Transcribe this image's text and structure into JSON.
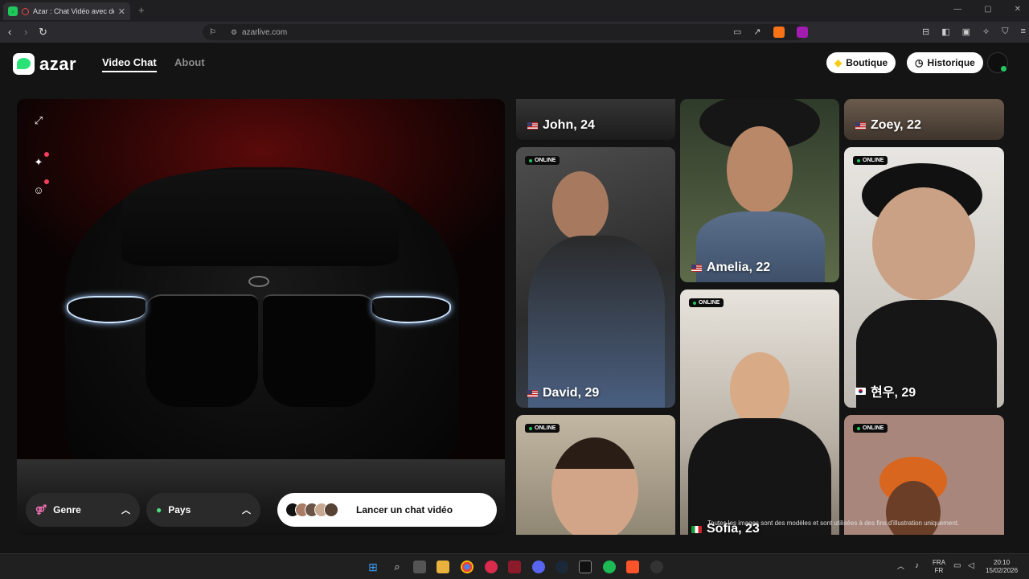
{
  "browser": {
    "tab_title": "Azar : Chat Vidéo avec de no",
    "tab_close": "✕",
    "new_tab": "+",
    "url": "azarlive.com",
    "window_controls": [
      "—",
      "▢",
      "✕"
    ]
  },
  "header": {
    "logo_text": "azar",
    "nav": {
      "video_chat": "Video Chat",
      "about": "About"
    },
    "boutique_label": "Boutique",
    "historique_label": "Historique"
  },
  "video_panel": {
    "filters": {
      "genre_label": "Genre",
      "pays_label": "Pays"
    },
    "launch_label": "Lancer un chat vidéo"
  },
  "profiles": [
    {
      "name": "John, 24",
      "flag": "us",
      "online": false
    },
    {
      "name": "Amelia, 22",
      "flag": "us",
      "online": false
    },
    {
      "name": "Zoey, 22",
      "flag": "us",
      "online": false
    },
    {
      "name": "David, 29",
      "flag": "us",
      "online": true
    },
    {
      "name": "Sofia, 23",
      "flag": "it",
      "online": true
    },
    {
      "name": "현우, 29",
      "flag": "kr",
      "online": true
    },
    {
      "name": "",
      "flag": "",
      "online": true
    },
    {
      "name": "",
      "flag": "",
      "online": true
    }
  ],
  "online_label": "ONLINE",
  "disclaimer": "Toutes les images sont des modèles et sont utilisées à des fins d'illustration uniquement.",
  "taskbar": {
    "lang_top": "FRA",
    "lang_bottom": "FR",
    "time": "20:10",
    "date": "15/02/2026"
  },
  "colors": {
    "brand_green": "#2ae277",
    "online_dot": "#22c55e",
    "notification": "#f43f5e"
  }
}
